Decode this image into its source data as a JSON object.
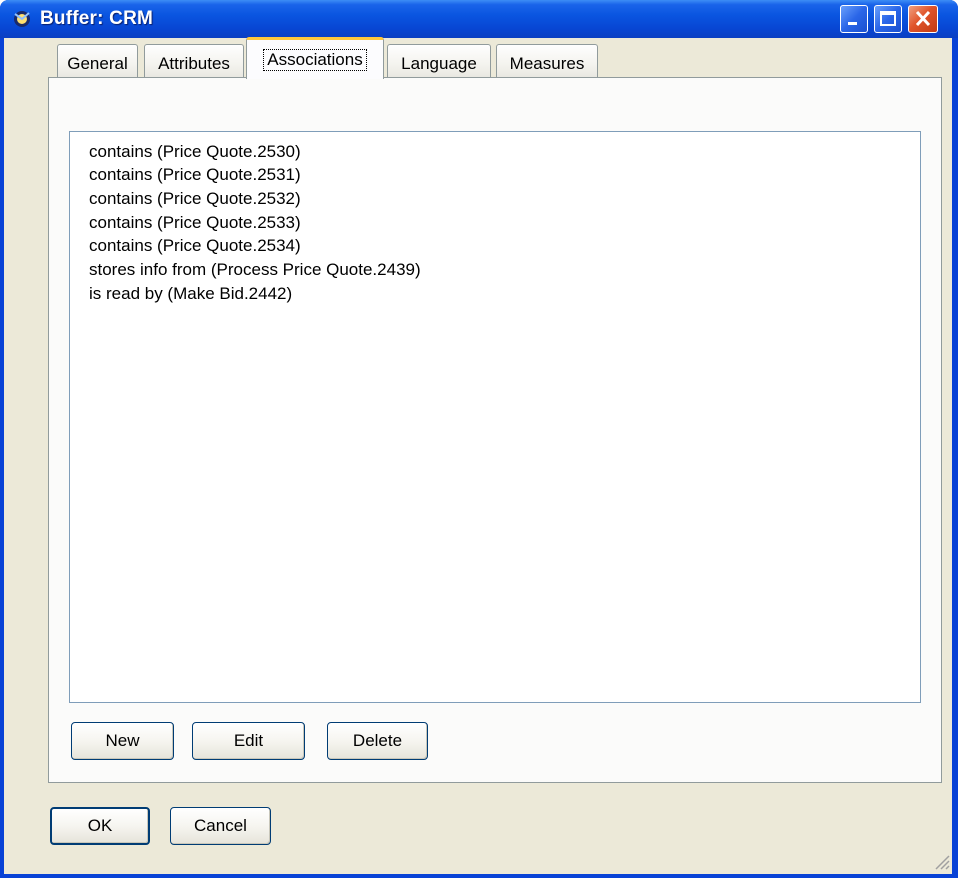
{
  "window": {
    "title": "Buffer: CRM",
    "icon": "app-icon",
    "controls": [
      "minimize-icon",
      "maximize-icon",
      "close-icon"
    ]
  },
  "tabs": [
    {
      "label": "General",
      "active": false
    },
    {
      "label": "Attributes",
      "active": false
    },
    {
      "label": "Associations",
      "active": true
    },
    {
      "label": "Language",
      "active": false
    },
    {
      "label": "Measures",
      "active": false
    }
  ],
  "associations": [
    "contains (Price Quote.2530)",
    "contains (Price Quote.2531)",
    "contains (Price Quote.2532)",
    "contains (Price Quote.2533)",
    "contains (Price Quote.2534)",
    "stores info from (Process Price Quote.2439)",
    "is read by (Make Bid.2442)"
  ],
  "panel_buttons": {
    "new": "New",
    "edit": "Edit",
    "delete": "Delete"
  },
  "dialog_buttons": {
    "ok": "OK",
    "cancel": "Cancel"
  },
  "colors": {
    "titlebar": "#0a55e0",
    "dialog_face": "#ece9d8",
    "active_tab_accent": "#ffc83c",
    "close_button": "#e0542a"
  }
}
